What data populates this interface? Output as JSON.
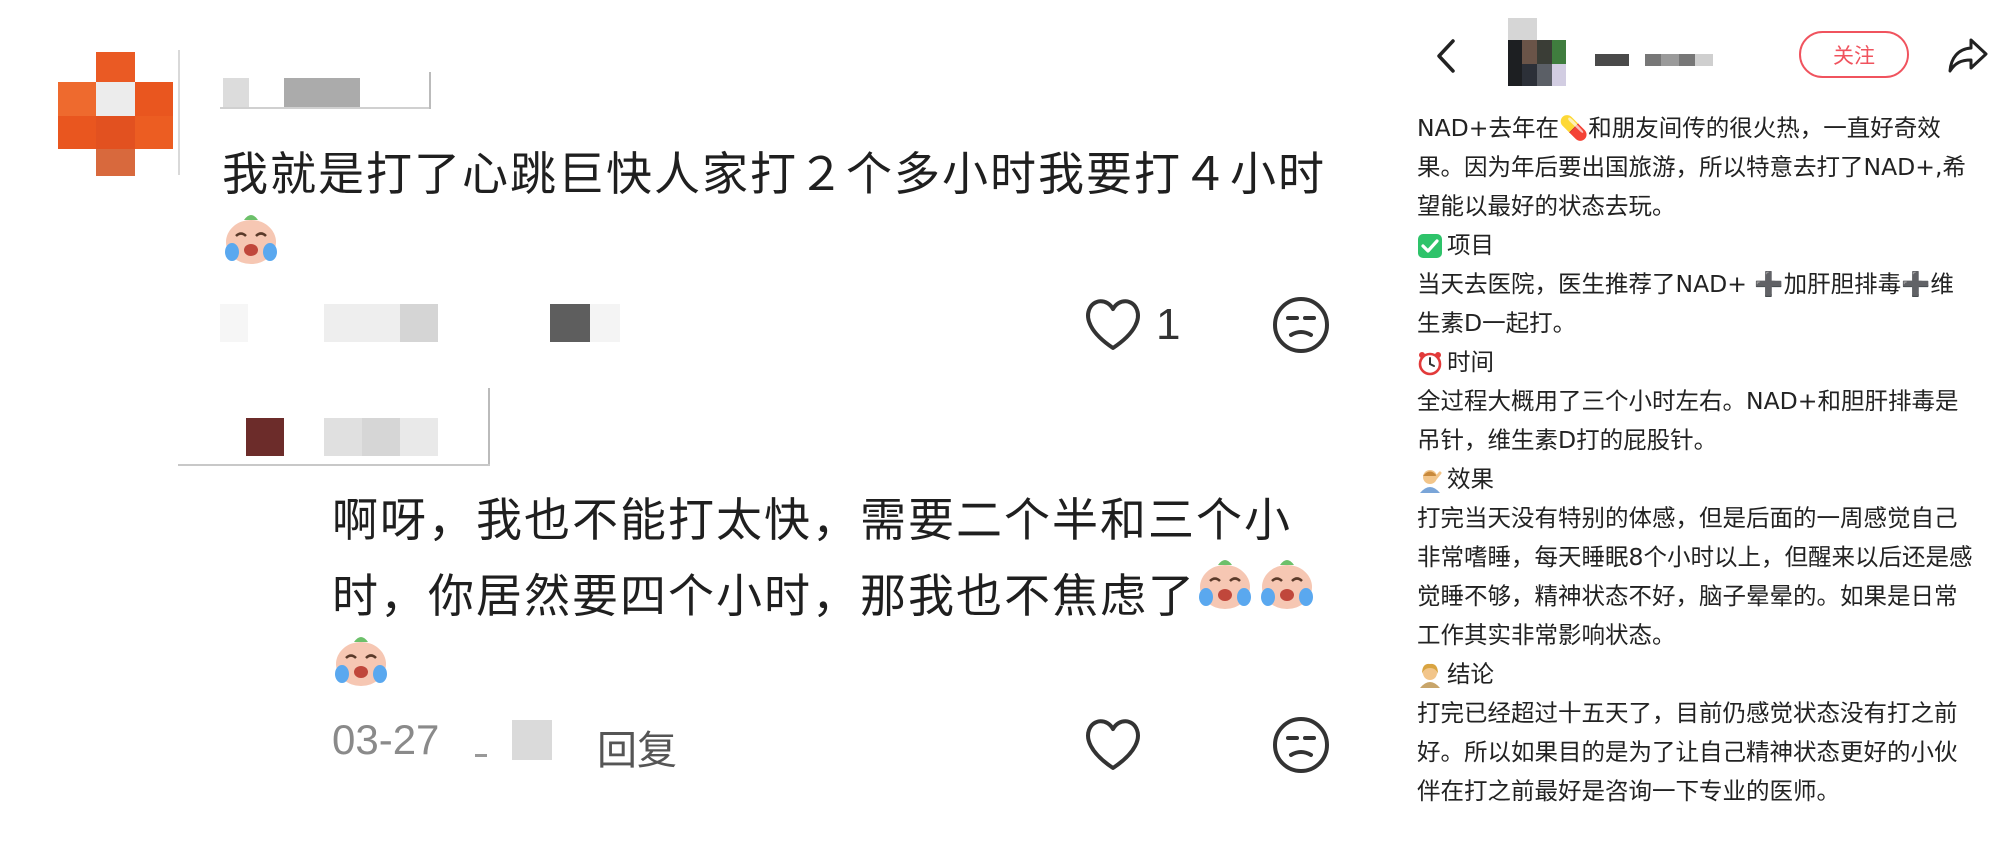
{
  "comments": {
    "main": {
      "line1": "我就是打了心跳巨快人家打２个多小时我要打４小时",
      "like_count": "1"
    },
    "reply": {
      "line1": "啊呀，我也不能打太快，需要二个半和三个小",
      "line2": "时，你居然要四个小时，那我也不焦虑了",
      "date": "03-27",
      "reply_label": "回复"
    }
  },
  "post": {
    "follow_label": "关注",
    "intro": "NAD+去年在💊和朋友间传的很火热，一直好奇效果。因为年后要出国旅游，所以特意去打了NAD+,希望能以最好的状态去玩。",
    "sections": [
      {
        "icon": "check-icon",
        "title": "项目",
        "body": "当天去医院，医生推荐了NAD+ ➕加肝胆排毒➕维生素D一起打。"
      },
      {
        "icon": "alarm-clock-icon",
        "title": "时间",
        "body": "全过程大概用了三个小时左右。NAD+和胆肝排毒是吊针，维生素D打的屁股针。"
      },
      {
        "icon": "person-icon",
        "title": "效果",
        "body": "打完当天没有特别的体感，但是后面的一周感觉自己非常嗜睡，每天睡眠8个小时以上，但醒来以后还是感觉睡不够，精神状态不好，脑子晕晕的。如果是日常工作其实非常影响状态。"
      },
      {
        "icon": "person-icon",
        "title": "结论",
        "body": "打完已经超过十五天了，目前仍感觉状态没有打之前好。所以如果目的是为了让自己精神状态更好的小伙伴在打之前最好是咨询一下专业的医师。"
      }
    ]
  },
  "colors": {
    "accent": "#f0535e",
    "check": "#2ec36a",
    "avatar": "#e9561f"
  }
}
